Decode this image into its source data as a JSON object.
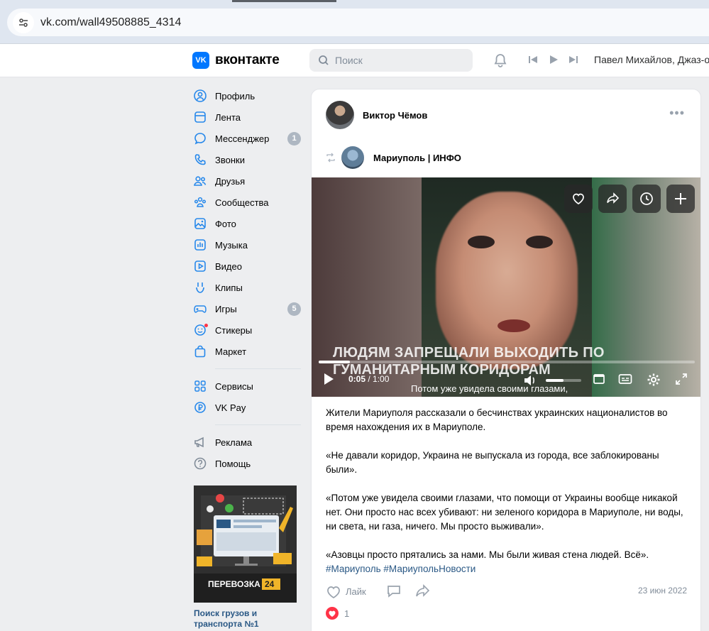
{
  "browser": {
    "url": "vk.com/wall49508885_4314"
  },
  "header": {
    "logo_text": "вконтакте",
    "logo_badge": "VK",
    "search_placeholder": "Поиск",
    "now_playing": "Павел Михайлов, Джаз-о"
  },
  "sidebar": {
    "items": [
      {
        "label": "Профиль",
        "icon": "profile-icon"
      },
      {
        "label": "Лента",
        "icon": "feed-icon"
      },
      {
        "label": "Мессенджер",
        "icon": "messenger-icon",
        "badge": "1"
      },
      {
        "label": "Звонки",
        "icon": "phone-icon"
      },
      {
        "label": "Друзья",
        "icon": "friends-icon"
      },
      {
        "label": "Сообщества",
        "icon": "communities-icon"
      },
      {
        "label": "Фото",
        "icon": "photo-icon"
      },
      {
        "label": "Музыка",
        "icon": "music-icon"
      },
      {
        "label": "Видео",
        "icon": "video-icon"
      },
      {
        "label": "Клипы",
        "icon": "clips-icon"
      },
      {
        "label": "Игры",
        "icon": "games-icon",
        "badge": "5"
      },
      {
        "label": "Стикеры",
        "icon": "stickers-icon"
      },
      {
        "label": "Маркет",
        "icon": "market-icon"
      }
    ],
    "items2": [
      {
        "label": "Сервисы",
        "icon": "services-icon"
      },
      {
        "label": "VK Pay",
        "icon": "vkpay-icon"
      }
    ],
    "items3": [
      {
        "label": "Реклама",
        "icon": "ads-icon"
      },
      {
        "label": "Помощь",
        "icon": "help-icon"
      }
    ],
    "ad": {
      "brand": "ПЕРЕВОЗКА",
      "brand_num": "24",
      "title": "Поиск грузов и транспорта №1"
    }
  },
  "post": {
    "author": "Виктор Чёмов",
    "source": "Мариуполь | ИНФО",
    "video": {
      "subtitle_line1": "ЛЮДЯМ ЗАПРЕЩАЛИ ВЫХОДИТЬ ПО",
      "subtitle_line2": "ГУМАНИТАРНЫМ КОРИДОРАМ",
      "caption": "Потом уже увидела своими глазами,",
      "time_current": "0:05",
      "time_total": " / 1:00",
      "progress_fraction": 0.083,
      "volume_fraction": 0.5
    },
    "paragraphs": [
      "Жители Мариуполя рассказали о бесчинствах украинских националистов во время нахождения их в Мариуполе.",
      "«Не давали коридор, Украина не выпускала из города, все заблокированы были».",
      "«Потом уже увидела своими глазами, что помощи от Украины вообще никакой нет. Они просто нас всех убивают: ни зеленого коридора в Мариуполе, ни воды, ни света, ни газа, ничего. Мы просто выживали».",
      "«Азовцы просто прятались за нами. Мы были живая стена людей. Всё»."
    ],
    "hashtags": [
      "#Мариуполь",
      "#МариупольНовости"
    ],
    "like_label": "Лайк",
    "date": "23 июн 2022",
    "reactions_count": "1"
  }
}
